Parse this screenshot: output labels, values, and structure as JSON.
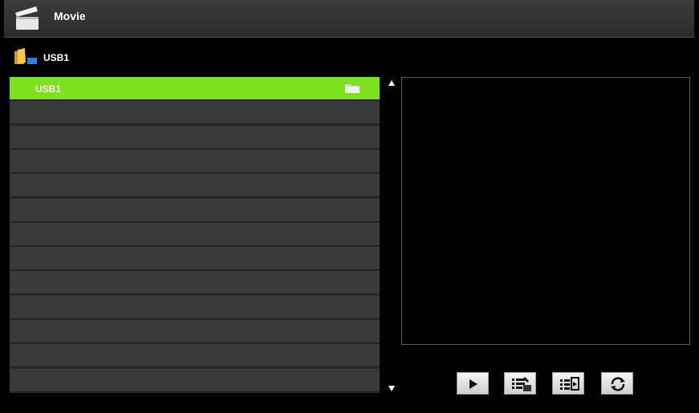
{
  "header": {
    "title": "Movie",
    "icon": "clapperboard-icon"
  },
  "breadcrumb": {
    "label": "USB1",
    "icon": "folder-icon"
  },
  "file_list": {
    "items": [
      {
        "name": "USB1",
        "type": "folder",
        "selected": true
      },
      {
        "name": "",
        "type": "empty"
      },
      {
        "name": "",
        "type": "empty"
      },
      {
        "name": "",
        "type": "empty"
      },
      {
        "name": "",
        "type": "empty"
      },
      {
        "name": "",
        "type": "empty"
      },
      {
        "name": "",
        "type": "empty"
      },
      {
        "name": "",
        "type": "empty"
      },
      {
        "name": "",
        "type": "empty"
      },
      {
        "name": "",
        "type": "empty"
      },
      {
        "name": "",
        "type": "empty"
      },
      {
        "name": "",
        "type": "empty"
      },
      {
        "name": "",
        "type": "empty"
      }
    ]
  },
  "controls": [
    {
      "icon": "play-icon"
    },
    {
      "icon": "select-all-icon"
    },
    {
      "icon": "playlist-icon"
    },
    {
      "icon": "repeat-icon"
    }
  ],
  "colors": {
    "selected": "#7de21b",
    "row": "#3a3a3a",
    "background": "#000000"
  }
}
